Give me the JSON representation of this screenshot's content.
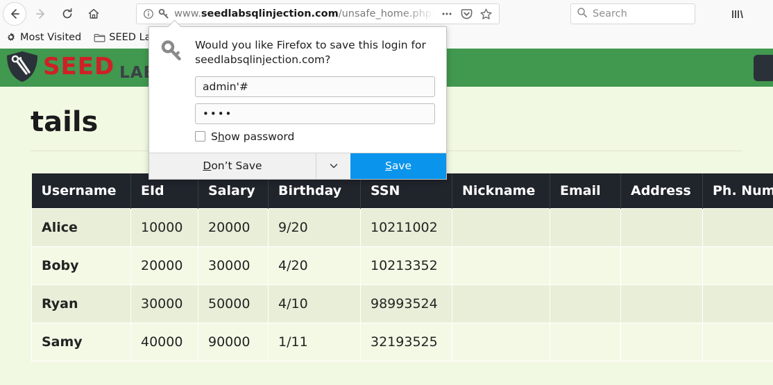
{
  "browser": {
    "nav": {
      "back_label": "Back",
      "forward_label": "Forward",
      "reload_label": "Reload",
      "home_label": "Home"
    },
    "urlbar": {
      "scheme_prefix": "www.",
      "host": "seedlabsqlinjection.com",
      "path": "/unsafe_home.php?username=adm",
      "full_url": "www.seedlabsqlinjection.com/unsafe_home.php?username=adm",
      "info_icon": "info-icon",
      "key_icon": "key-icon",
      "page_actions_icon": "ellipsis-icon",
      "pocket_icon": "pocket-icon",
      "bookmark_icon": "star-icon"
    },
    "search": {
      "placeholder": "Search",
      "icon": "search-icon"
    },
    "library_icon": "library-icon",
    "bookmarks": [
      {
        "label": "Most Visited",
        "icon": "gear-icon"
      },
      {
        "label": "SEED Labs",
        "icon": "folder-icon"
      }
    ]
  },
  "doorhanger": {
    "icon": "key-icon",
    "prompt": "Would you like Firefox to save this login for seedlabsqlinjection.com?",
    "username_value": "admin'#",
    "password_value": "••••",
    "show_password": {
      "label_before": "S",
      "label_accesskey": "h",
      "label_after": "ow password",
      "full_label": "Show password",
      "checked": false
    },
    "dont_save": {
      "label_before": "D",
      "label_accesskey": "o",
      "label_after": "n’t Save",
      "full_label": "Don’t Save"
    },
    "dropdown_icon": "chevron-down-icon",
    "save": {
      "label_before": "",
      "label_accesskey": "S",
      "label_after": "ave",
      "full_label": "Save"
    },
    "primary_color": "#0a94ec"
  },
  "site": {
    "navbar_color": "#41984f",
    "background_color": "#f2f9e3",
    "logo": {
      "shield_icon": "shield-tools-icon",
      "seed_text": "SEED",
      "labs_text": "LABS",
      "seed_color": "#cf2026",
      "labs_color": "#3b4046"
    },
    "navbar_toggle_icon": "navbar-toggle-icon",
    "heading": "tails",
    "table": {
      "header_color": "#20242b",
      "columns": [
        "Username",
        "EId",
        "Salary",
        "Birthday",
        "SSN",
        "Nickname",
        "Email",
        "Address",
        "Ph. Number"
      ],
      "rows": [
        {
          "cells": [
            "Alice",
            "10000",
            "20000",
            "9/20",
            "10211002",
            "",
            "",
            "",
            ""
          ]
        },
        {
          "cells": [
            "Boby",
            "20000",
            "30000",
            "4/20",
            "10213352",
            "",
            "",
            "",
            ""
          ]
        },
        {
          "cells": [
            "Ryan",
            "30000",
            "50000",
            "4/10",
            "98993524",
            "",
            "",
            "",
            ""
          ]
        },
        {
          "cells": [
            "Samy",
            "40000",
            "90000",
            "1/11",
            "32193525",
            "",
            "",
            "",
            ""
          ]
        }
      ]
    }
  }
}
